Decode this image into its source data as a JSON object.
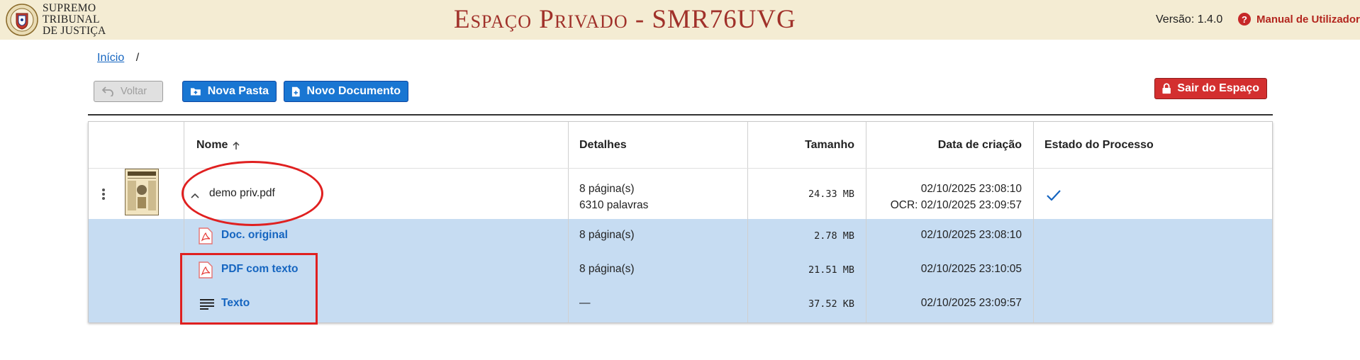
{
  "header": {
    "logo_lines": [
      "SUPREMO",
      "TRIBUNAL",
      "DE JUSTIÇA"
    ],
    "title": "Espaço Privado - SMR76UVG",
    "version": "Versão: 1.4.0",
    "manual_label": "Manual de Utilizador"
  },
  "breadcrumb": {
    "home": "Início",
    "separator": "/"
  },
  "toolbar": {
    "back_label": "Voltar",
    "new_folder_label": "Nova Pasta",
    "new_document_label": "Novo Documento",
    "exit_label": "Sair do Espaço"
  },
  "table": {
    "headers": {
      "name": "Nome",
      "details": "Detalhes",
      "size": "Tamanho",
      "created": "Data de criação",
      "status": "Estado do Processo"
    },
    "file": {
      "name": "demo priv.pdf",
      "details_pages": "8 página(s)",
      "details_words": "6310 palavras",
      "size": "24.33 MB",
      "created": "02/10/2025 23:08:10",
      "ocr": "OCR: 02/10/2025 23:09:57",
      "status": "done"
    },
    "subrows": [
      {
        "name": "Doc. original",
        "icon": "pdf-icon",
        "details": "8 página(s)",
        "size": "2.78 MB",
        "created": "02/10/2025 23:08:10"
      },
      {
        "name": "PDF com texto",
        "icon": "pdf-icon",
        "details": "8 página(s)",
        "size": "21.51 MB",
        "created": "02/10/2025 23:10:05"
      },
      {
        "name": "Texto",
        "icon": "text-lines-icon",
        "details": "—",
        "size": "37.52 KB",
        "created": "02/10/2025 23:09:57"
      }
    ]
  },
  "colors": {
    "header_bg": "#f4ecd3",
    "title": "#a0312a",
    "primary": "#1976d2",
    "danger": "#d32f2f",
    "subrow_bg": "#c6dcf2",
    "highlight": "#e02020"
  }
}
